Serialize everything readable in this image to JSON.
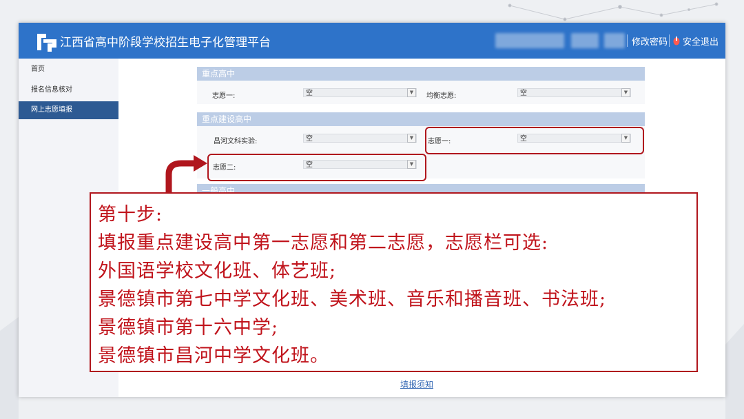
{
  "header": {
    "title": "江西省高中阶段学校招生电子化管理平台",
    "change_password": "修改密码",
    "logout": "安全退出"
  },
  "sidebar": {
    "items": [
      {
        "label": "首页",
        "active": false
      },
      {
        "label": "报名信息核对",
        "active": false
      },
      {
        "label": "网上志愿填报",
        "active": true
      }
    ]
  },
  "sections": {
    "key_high": {
      "title": "重点高中",
      "choice1_label": "志愿一:",
      "choice1_value": "空",
      "balance_label": "均衡志愿:",
      "balance_value": "空"
    },
    "key_build": {
      "title": "重点建设高中",
      "changhe_label": "昌河文科实验:",
      "changhe_value": "空",
      "choice1_label": "志愿一:",
      "choice1_value": "空",
      "choice2_label": "志愿二:",
      "choice2_value": "空"
    },
    "general": {
      "title": "一般高中"
    }
  },
  "callout": {
    "lines": [
      "第十步:",
      "填报重点建设高中第一志愿和第二志愿，志愿栏可选:",
      "外国语学校文化班、体艺班;",
      "景德镇市第七中学文化班、美术班、音乐和播音班、书法班;",
      "景德镇市第十六中学;",
      "景德镇市昌河中学文化班。"
    ]
  },
  "footer": {
    "link": "填报须知"
  },
  "colors": {
    "header_bg": "#2e73c9",
    "highlight": "#b0161d",
    "sidebar_active": "#2d5a93"
  }
}
